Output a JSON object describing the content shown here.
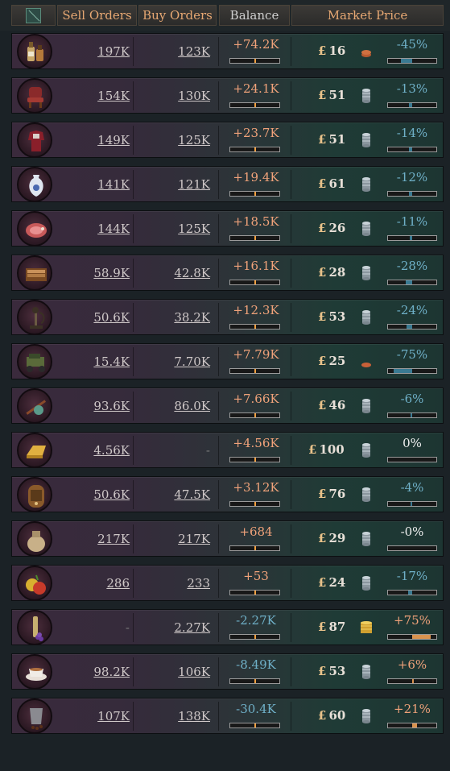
{
  "header": {
    "sell_orders": "Sell Orders",
    "buy_orders": "Buy Orders",
    "balance": "Balance",
    "market_price": "Market Price"
  },
  "currency_symbol": "£",
  "rows": [
    {
      "good": "liquor-icon",
      "sell": "197K",
      "buy": "123K",
      "balance": "+74.2K",
      "balance_sign": "pos",
      "price": "16",
      "coins": "few-bronze",
      "change": "-45%",
      "change_sign": "neg",
      "change_fraction": -0.45
    },
    {
      "good": "luxury-furniture-icon",
      "sell": "154K",
      "buy": "130K",
      "balance": "+24.1K",
      "balance_sign": "pos",
      "price": "51",
      "coins": "stack-silver",
      "change": "-13%",
      "change_sign": "neg",
      "change_fraction": -0.13
    },
    {
      "good": "luxury-clothes-icon",
      "sell": "149K",
      "buy": "125K",
      "balance": "+23.7K",
      "balance_sign": "pos",
      "price": "51",
      "coins": "stack-silver",
      "change": "-14%",
      "change_sign": "neg",
      "change_fraction": -0.14
    },
    {
      "good": "porcelain-icon",
      "sell": "141K",
      "buy": "121K",
      "balance": "+19.4K",
      "balance_sign": "pos",
      "price": "61",
      "coins": "stack-silver",
      "change": "-12%",
      "change_sign": "neg",
      "change_fraction": -0.12
    },
    {
      "good": "meat-icon",
      "sell": "144K",
      "buy": "125K",
      "balance": "+18.5K",
      "balance_sign": "pos",
      "price": "26",
      "coins": "stack-silver",
      "change": "-11%",
      "change_sign": "neg",
      "change_fraction": -0.11
    },
    {
      "good": "tobacco-icon",
      "sell": "58.9K",
      "buy": "42.8K",
      "balance": "+16.1K",
      "balance_sign": "pos",
      "price": "28",
      "coins": "stack-silver",
      "change": "-28%",
      "change_sign": "neg",
      "change_fraction": -0.28
    },
    {
      "good": "telephone-icon",
      "sell": "50.6K",
      "buy": "38.2K",
      "balance": "+12.3K",
      "balance_sign": "pos",
      "price": "53",
      "coins": "stack-silver",
      "change": "-24%",
      "change_sign": "neg",
      "change_fraction": -0.24
    },
    {
      "good": "automobile-icon",
      "sell": "15.4K",
      "buy": "7.70K",
      "balance": "+7.79K",
      "balance_sign": "pos",
      "price": "25",
      "coins": "single-bronze",
      "change": "-75%",
      "change_sign": "neg",
      "change_fraction": -0.75
    },
    {
      "good": "opium-icon",
      "sell": "93.6K",
      "buy": "86.0K",
      "balance": "+7.66K",
      "balance_sign": "pos",
      "price": "46",
      "coins": "stack-silver",
      "change": "-6%",
      "change_sign": "neg",
      "change_fraction": -0.06
    },
    {
      "good": "gold-icon",
      "sell": "4.56K",
      "buy": "-",
      "balance": "+4.56K",
      "balance_sign": "pos",
      "price": "100",
      "coins": "stack-silver",
      "change": "0%",
      "change_sign": "zero",
      "change_fraction": 0
    },
    {
      "good": "radio-icon",
      "sell": "50.6K",
      "buy": "47.5K",
      "balance": "+3.12K",
      "balance_sign": "pos",
      "price": "76",
      "coins": "stack-silver",
      "change": "-4%",
      "change_sign": "neg",
      "change_fraction": -0.04
    },
    {
      "good": "grain-icon",
      "sell": "217K",
      "buy": "217K",
      "balance": "+684",
      "balance_sign": "pos",
      "price": "29",
      "coins": "stack-silver",
      "change": "-0%",
      "change_sign": "zero",
      "change_fraction": 0
    },
    {
      "good": "fruit-icon",
      "sell": "286",
      "buy": "233",
      "balance": "+53",
      "balance_sign": "pos",
      "price": "24",
      "coins": "stack-silver",
      "change": "-17%",
      "change_sign": "neg",
      "change_fraction": -0.17
    },
    {
      "good": "wine-icon",
      "sell": "-",
      "buy": "2.27K",
      "balance": "-2.27K",
      "balance_sign": "neg",
      "price": "87",
      "coins": "stack-gold",
      "change": "+75%",
      "change_sign": "pos",
      "change_fraction": 0.75
    },
    {
      "good": "tea-icon",
      "sell": "98.2K",
      "buy": "106K",
      "balance": "-8.49K",
      "balance_sign": "neg",
      "price": "53",
      "coins": "stack-silver",
      "change": "+6%",
      "change_sign": "pos",
      "change_fraction": 0.06
    },
    {
      "good": "coffee-icon",
      "sell": "107K",
      "buy": "138K",
      "balance": "-30.4K",
      "balance_sign": "neg",
      "price": "60",
      "coins": "stack-silver",
      "change": "+21%",
      "change_sign": "pos",
      "change_fraction": 0.21
    }
  ],
  "colors": {
    "positive": "#f0a27a",
    "negative": "#6fb0c8",
    "header_text": "#e7a873",
    "bar_positive": "#d9934f",
    "bar_negative": "#3a7a92"
  }
}
